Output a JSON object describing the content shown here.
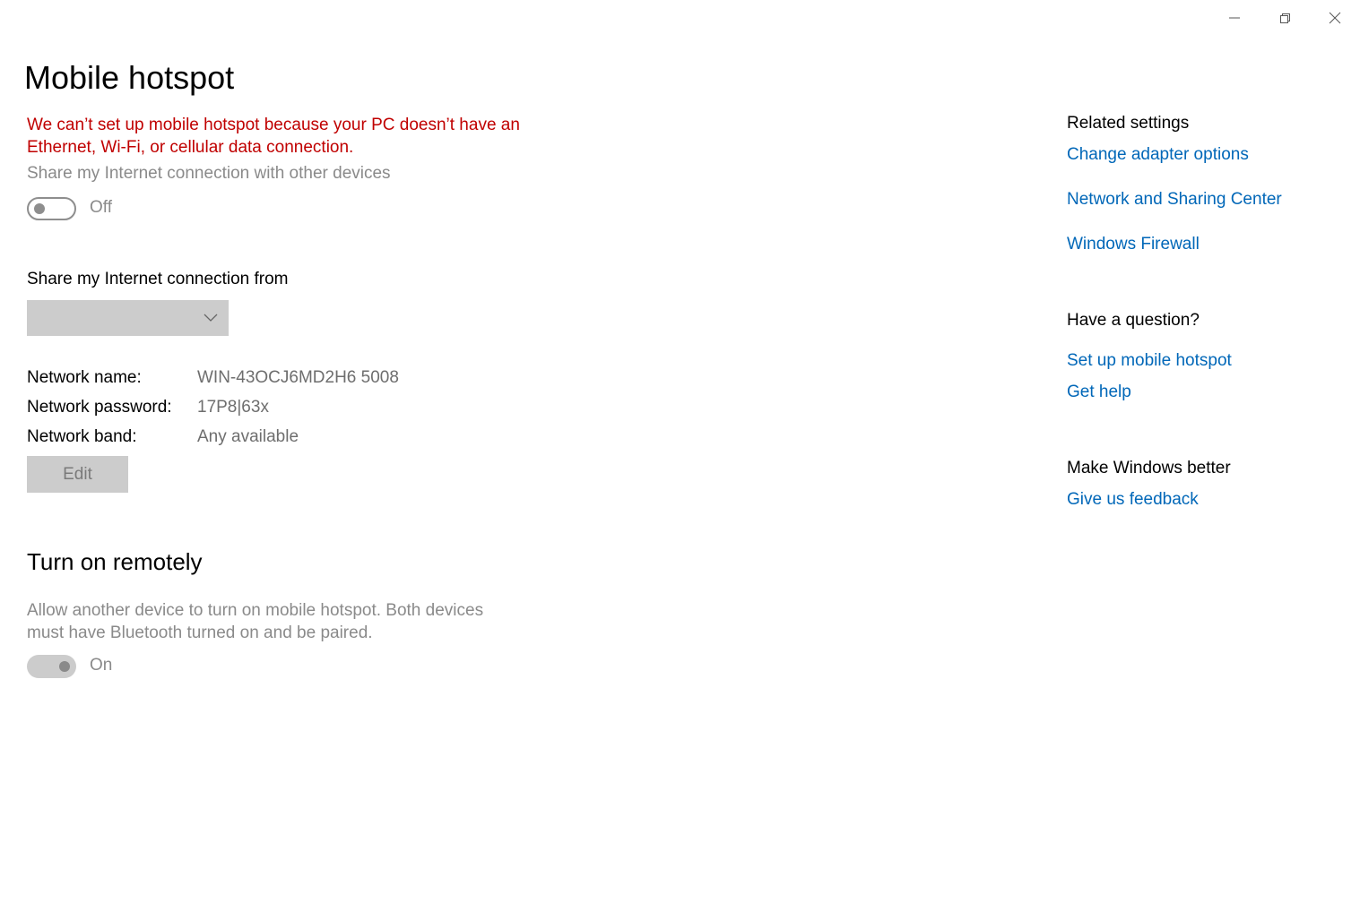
{
  "window": {
    "controls": {
      "minimize_icon": "minimize-icon",
      "restore_icon": "restore-icon",
      "close_icon": "close-icon"
    }
  },
  "page": {
    "title": "Mobile hotspot",
    "error_message": "We can’t set up mobile hotspot because your PC doesn’t have an Ethernet, Wi-Fi, or cellular data connection.",
    "share_toggle": {
      "caption": "Share my Internet connection with other devices",
      "state_label": "Off",
      "state": false
    },
    "share_from": {
      "label": "Share my Internet connection from",
      "selected_value": ""
    },
    "network": {
      "name_label": "Network name:",
      "name_value": "WIN-43OCJ6MD2H6 5008",
      "password_label": "Network password:",
      "password_value": "17P8|63x",
      "band_label": "Network band:",
      "band_value": "Any available",
      "edit_label": "Edit"
    },
    "remote": {
      "title": "Turn on remotely",
      "description": "Allow another device to turn on mobile hotspot. Both devices must have Bluetooth turned on and be paired.",
      "state_label": "On",
      "state": true
    }
  },
  "sidebar": {
    "related_heading": "Related settings",
    "related_links": [
      "Change adapter options",
      "Network and Sharing Center",
      "Windows Firewall"
    ],
    "question_heading": "Have a question?",
    "question_links": [
      "Set up mobile hotspot",
      "Get help"
    ],
    "feedback_heading": "Make Windows better",
    "feedback_link": "Give us feedback"
  },
  "colors": {
    "error": "#c00000",
    "link": "#0067b8",
    "disabled_text": "#8a8a8a",
    "control_fill": "#cccccc"
  }
}
